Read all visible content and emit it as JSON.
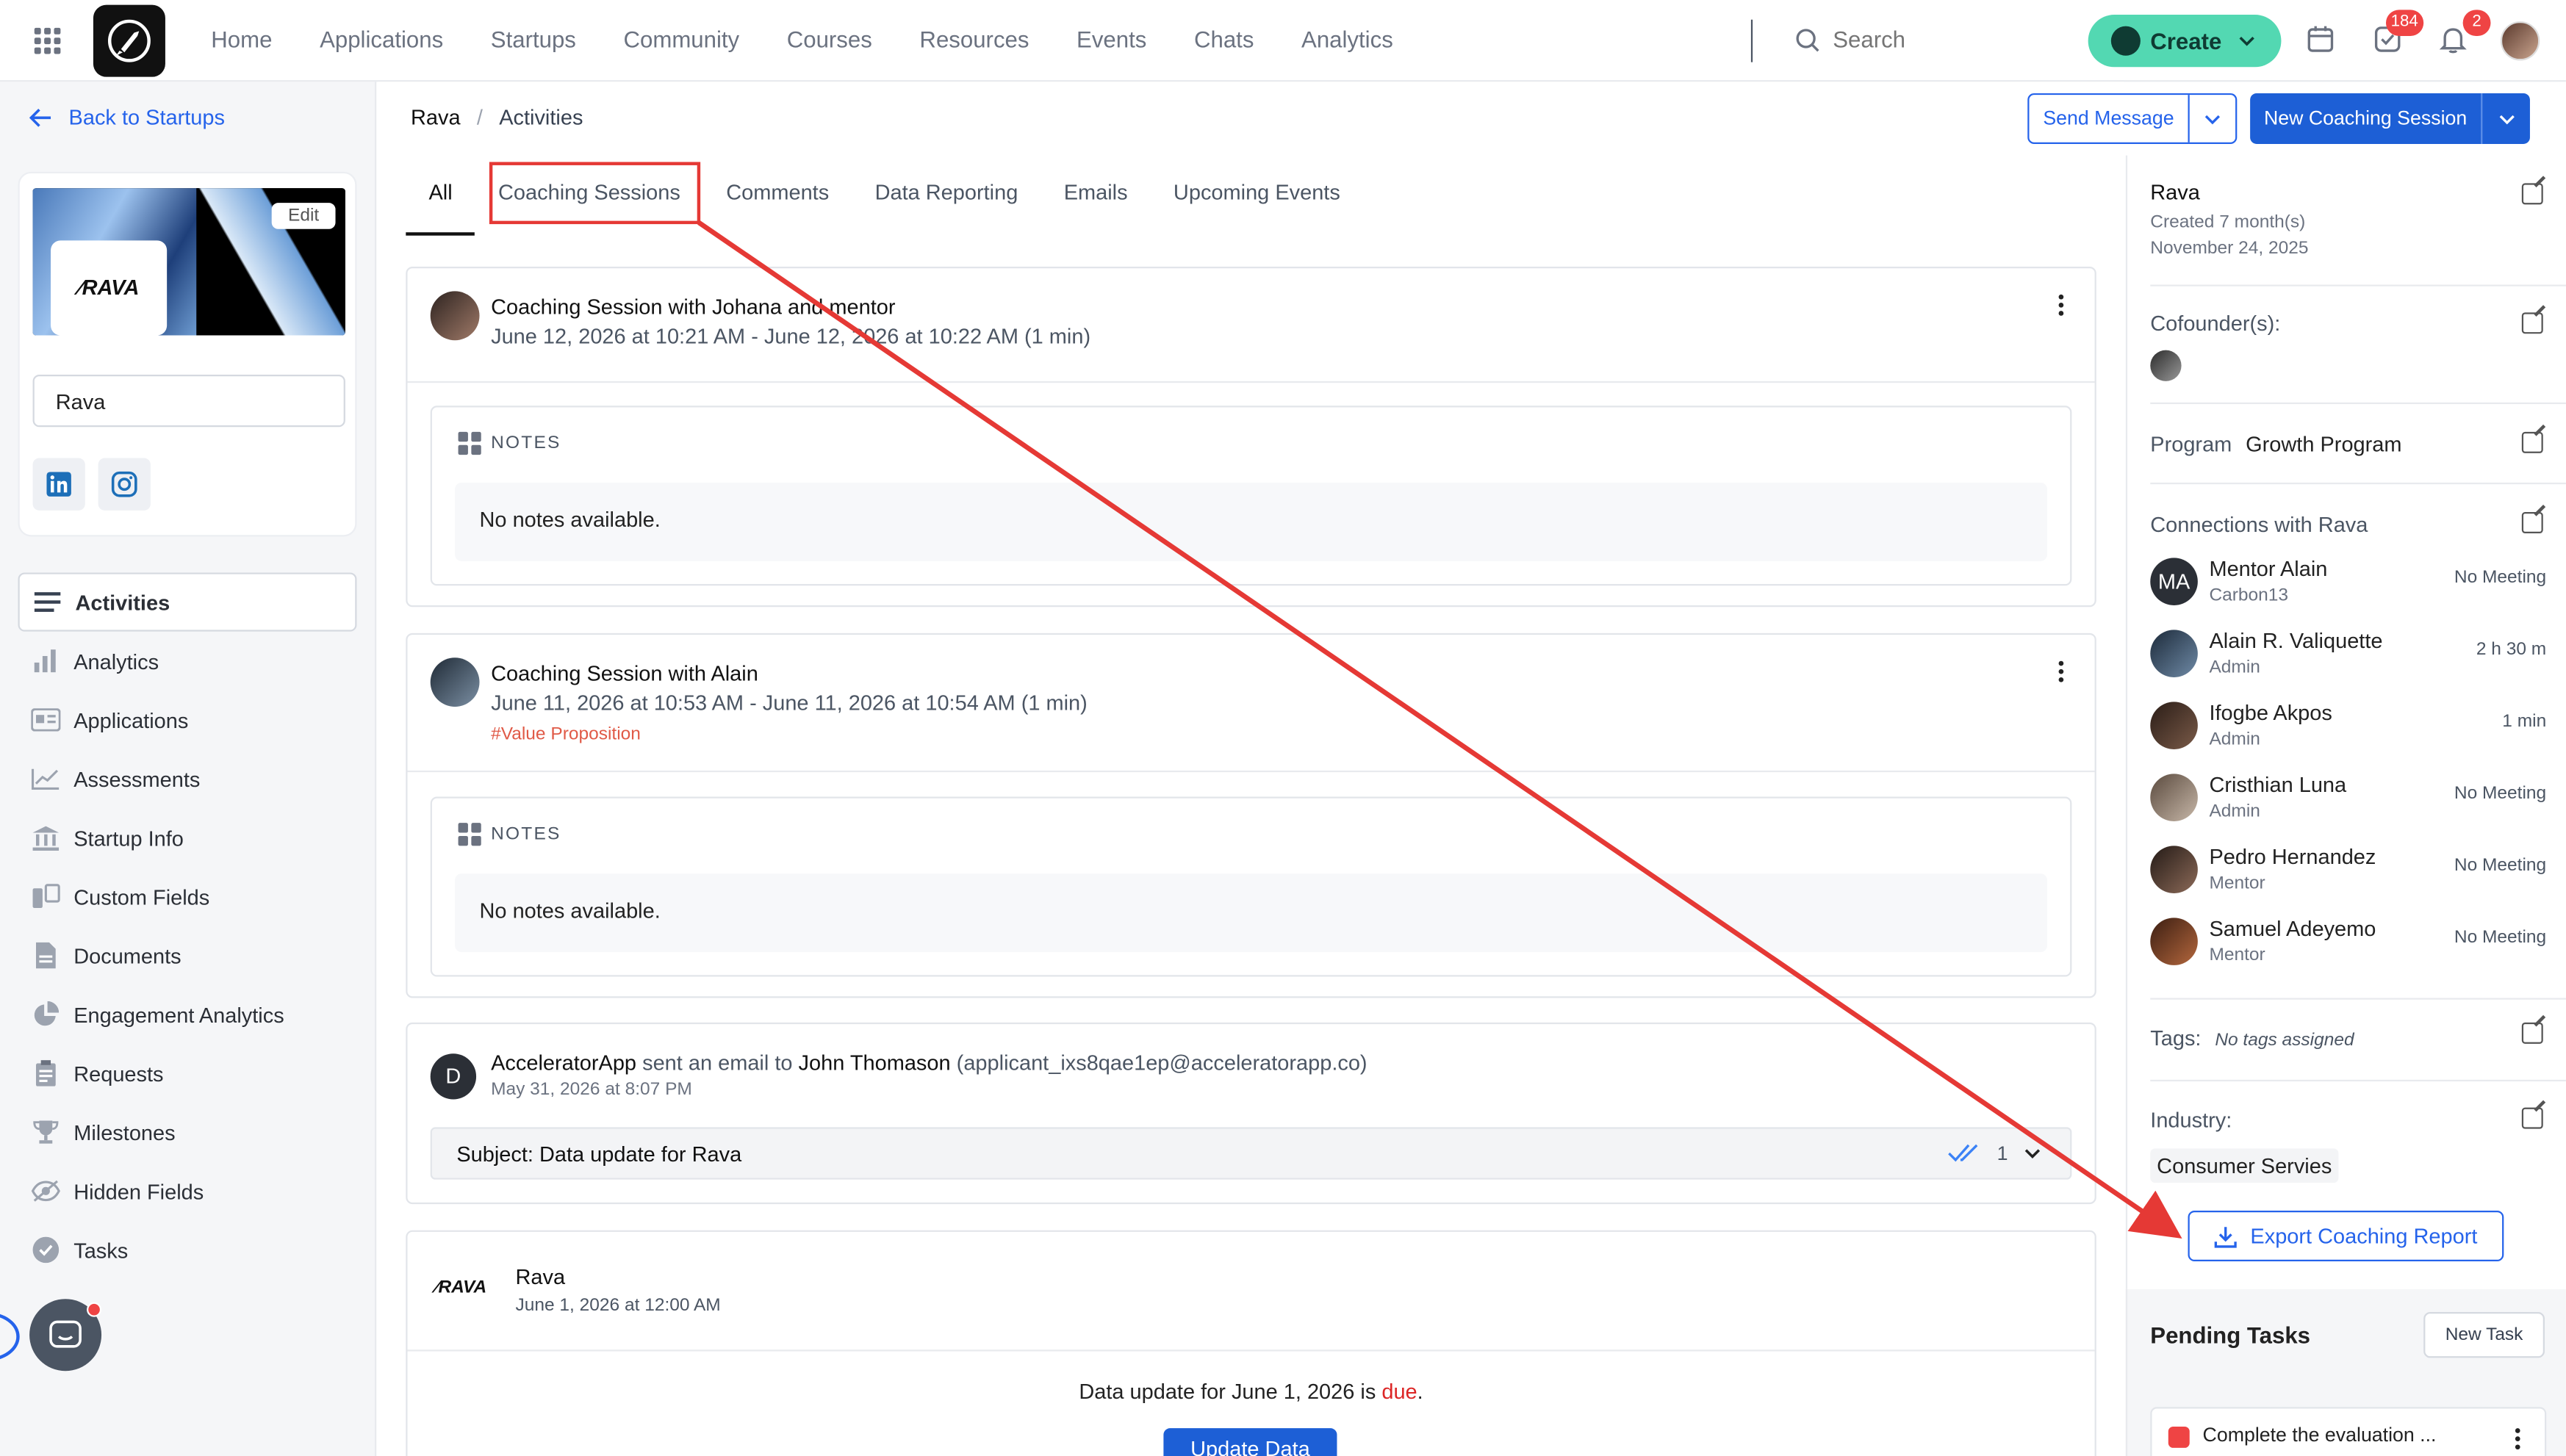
{
  "nav": {
    "links": [
      "Home",
      "Applications",
      "Startups",
      "Community",
      "Courses",
      "Resources",
      "Events",
      "Chats",
      "Analytics"
    ],
    "search_placeholder": "Search",
    "create_label": "Create",
    "tasks_badge": "184",
    "notifications_badge": "2"
  },
  "sidebar": {
    "back_label": "Back to Startups",
    "edit_label": "Edit",
    "logo_text": "⁄RAVA",
    "startup_name_value": "Rava",
    "items": [
      {
        "label": "Activities",
        "icon": "list-icon"
      },
      {
        "label": "Analytics",
        "icon": "bar-chart-icon"
      },
      {
        "label": "Applications",
        "icon": "id-card-icon"
      },
      {
        "label": "Assessments",
        "icon": "line-chart-icon"
      },
      {
        "label": "Startup Info",
        "icon": "bank-icon"
      },
      {
        "label": "Custom Fields",
        "icon": "fields-icon"
      },
      {
        "label": "Documents",
        "icon": "document-icon"
      },
      {
        "label": "Engagement Analytics",
        "icon": "pie-chart-icon"
      },
      {
        "label": "Requests",
        "icon": "clipboard-icon"
      },
      {
        "label": "Milestones",
        "icon": "trophy-icon"
      },
      {
        "label": "Hidden Fields",
        "icon": "eye-off-icon"
      },
      {
        "label": "Tasks",
        "icon": "check-circle-icon"
      }
    ]
  },
  "header": {
    "breadcrumb_root": "Rava",
    "breadcrumb_sep": "/",
    "breadcrumb_current": "Activities",
    "send_message_label": "Send Message",
    "new_session_label": "New Coaching Session"
  },
  "tabs": [
    "All",
    "Coaching Sessions",
    "Comments",
    "Data Reporting",
    "Emails",
    "Upcoming Events"
  ],
  "activities": {
    "session1": {
      "title": "Coaching Session with Johana and mentor",
      "time": "June 12, 2026 at 10:21 AM - June 12, 2026 at 10:22 AM (1 min)",
      "notes_label": "NOTES",
      "notes_body": "No notes available."
    },
    "session2": {
      "title": "Coaching Session with Alain",
      "time": "June 11, 2026 at 10:53 AM - June 11, 2026 at 10:54 AM (1 min)",
      "tag": "#Value Proposition",
      "notes_label": "NOTES",
      "notes_body": "No notes available."
    },
    "email": {
      "avatar_letter": "D",
      "sender": "AcceleratorApp",
      "action": " sent an email to ",
      "recipient": "John Thomason",
      "address": " (applicant_ixs8qae1ep@acceleratorapp.co)",
      "time": "May 31, 2026 at 8:07 PM",
      "subject": "Subject: Data update for Rava",
      "count": "1"
    },
    "data_update": {
      "logo_text": "⁄RAVA",
      "title": "Rava",
      "time": "June 1, 2026 at 12:00 AM",
      "due_prefix": "Data update for June 1, 2026 is ",
      "due_word": "due",
      "due_suffix": ".",
      "button_label": "Update Data"
    }
  },
  "right_panel": {
    "name": "Rava",
    "created": "Created 7 month(s)",
    "created_date": "November 24, 2025",
    "cofounders_label": "Cofounder(s):",
    "program_label": "Program",
    "program_value": "Growth Program",
    "connections_label": "Connections with Rava",
    "connections": [
      {
        "initials": "MA",
        "name": "Mentor Alain",
        "role": "Carbon13",
        "status": "No Meeting"
      },
      {
        "initials": "",
        "name": "Alain R. Valiquette",
        "role": "Admin",
        "status": "2 h 30 m"
      },
      {
        "initials": "",
        "name": "Ifogbe Akpos",
        "role": "Admin",
        "status": "1 min"
      },
      {
        "initials": "",
        "name": "Cristhian Luna",
        "role": "Admin",
        "status": "No Meeting"
      },
      {
        "initials": "",
        "name": "Pedro Hernandez",
        "role": "Mentor",
        "status": "No Meeting"
      },
      {
        "initials": "",
        "name": "Samuel Adeyemo",
        "role": "Mentor",
        "status": "No Meeting"
      }
    ],
    "tags_label": "Tags:",
    "tags_value": "No tags assigned",
    "industry_label": "Industry:",
    "industry_value": "Consumer Servies",
    "export_label": "Export Coaching Report",
    "pending_title": "Pending Tasks",
    "new_task_label": "New Task",
    "task_text": "Complete the evaluation ..."
  },
  "colors": {
    "accent_blue": "#1d5fd6",
    "create_green": "#53d8b2",
    "annotation_red": "#e53935",
    "due_red": "#dc2626"
  }
}
